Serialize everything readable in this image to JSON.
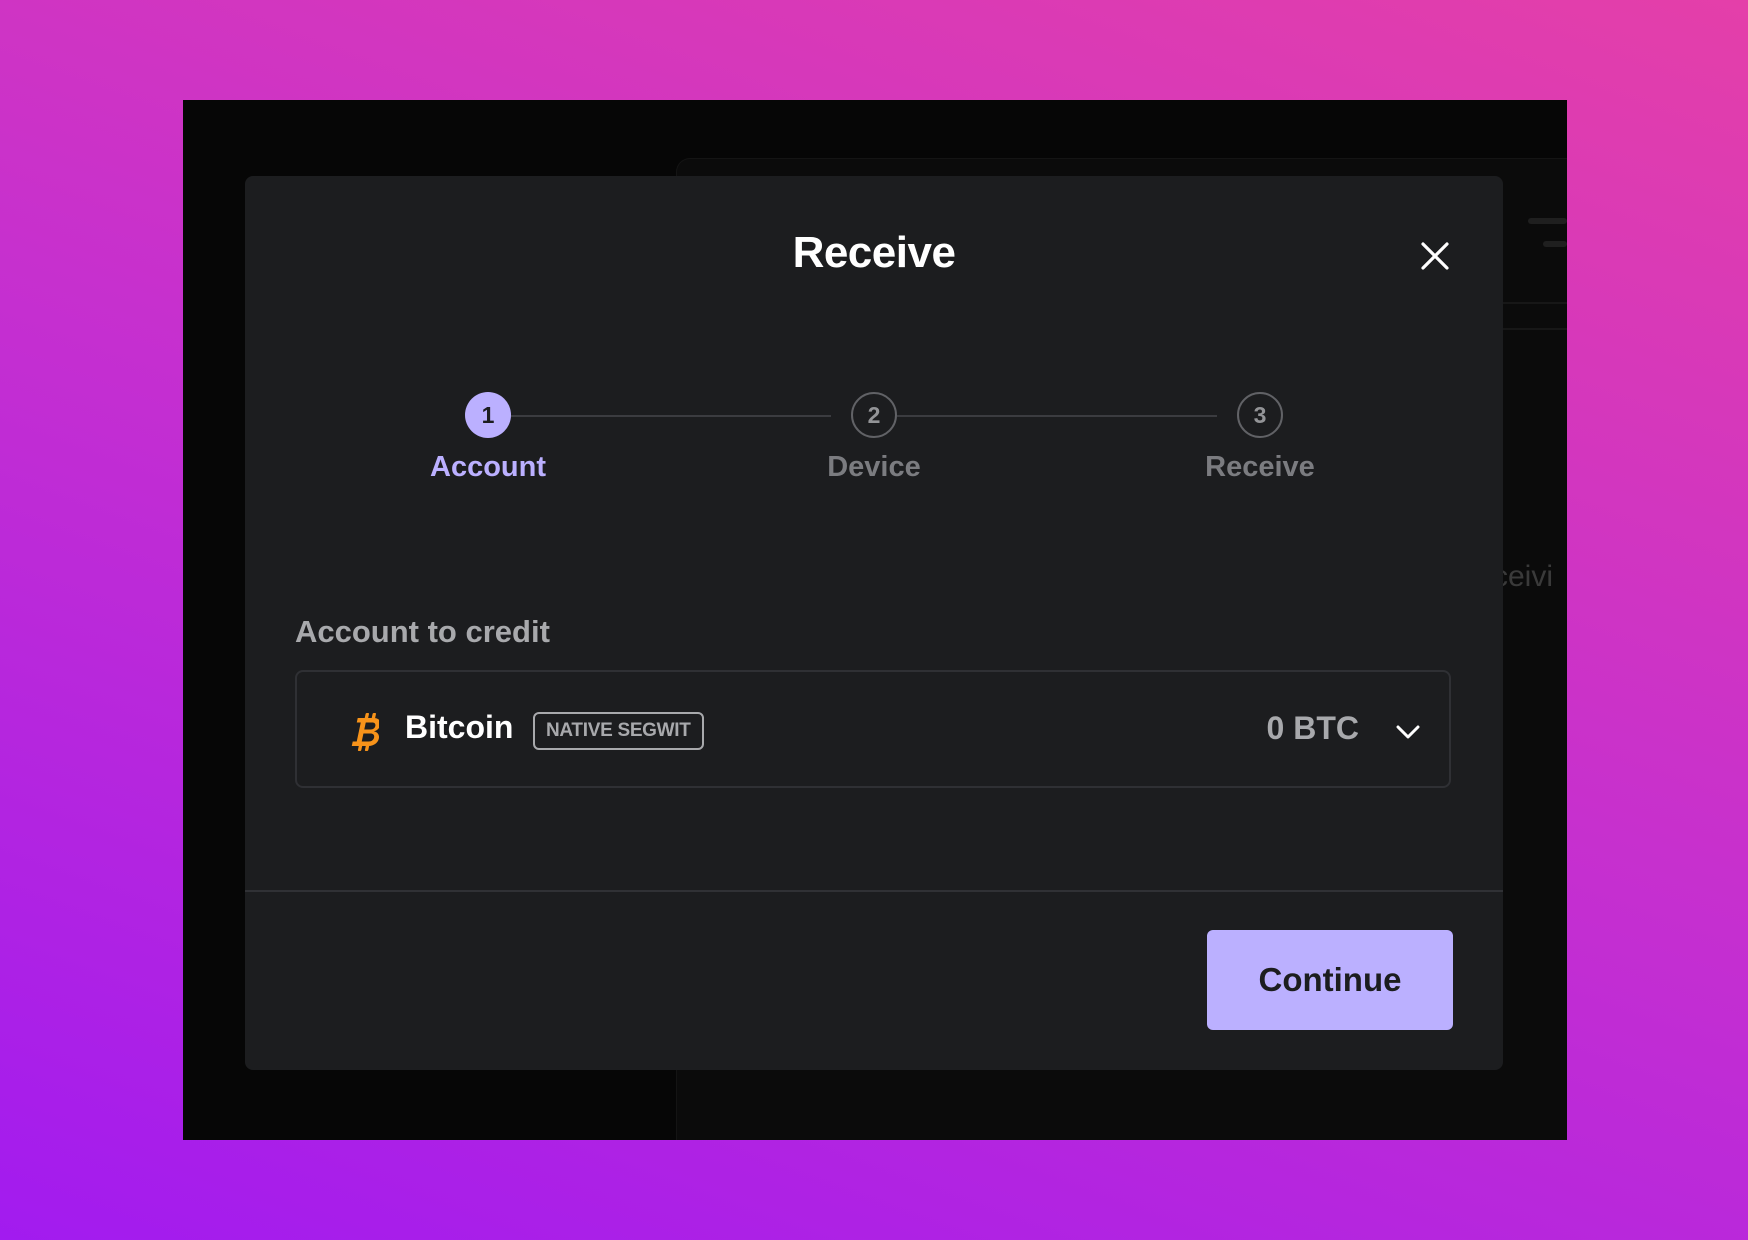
{
  "modal": {
    "title": "Receive",
    "close_icon": "close-icon"
  },
  "stepper": {
    "steps": [
      {
        "number": "1",
        "label": "Account",
        "state": "active"
      },
      {
        "number": "2",
        "label": "Device",
        "state": "inactive"
      },
      {
        "number": "3",
        "label": "Receive",
        "state": "inactive"
      }
    ]
  },
  "account": {
    "label": "Account to credit",
    "name": "Bitcoin",
    "tag": "NATIVE SEGWIT",
    "balance": "0 BTC",
    "icon": "bitcoin-icon",
    "dropdown_icon": "chevron-down-icon"
  },
  "footer": {
    "continue_label": "Continue"
  },
  "background": {
    "partial_text": "ceivi"
  },
  "colors": {
    "accent": "#bbb0ff",
    "modal_bg": "#1c1d1f",
    "bitcoin_orange": "#f7931a"
  }
}
